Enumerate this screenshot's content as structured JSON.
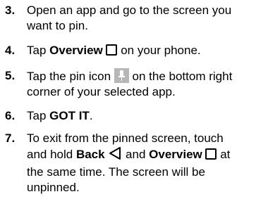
{
  "steps": [
    {
      "number": "3.",
      "line1": "Open an app and go to the screen you",
      "line2": "want to pin."
    },
    {
      "number": "4.",
      "pre": "Tap ",
      "keyword": "Overview",
      "post": " on your phone.",
      "icon": "overview-square-icon"
    },
    {
      "number": "5.",
      "pre": "Tap the pin icon ",
      "post": " on the bottom right",
      "line2": "corner of your selected app.",
      "icon": "pin-icon"
    },
    {
      "number": "6.",
      "pre": "Tap ",
      "keyword": "GOT IT",
      "post": "."
    },
    {
      "number": "7.",
      "line1": "To exit from the pinned screen, touch",
      "line2_pre": "and hold ",
      "line2_kw1": "Back",
      "line2_and": " and ",
      "line2_kw2": "Overview",
      "line2_post": " at",
      "line3": "the same time. The screen will be",
      "line4": "unpinned.",
      "icons": [
        "back-triangle-icon",
        "overview-square-icon"
      ]
    }
  ],
  "colors": {
    "text": "#000000",
    "pin_icon_background": "#b7b7b7"
  }
}
